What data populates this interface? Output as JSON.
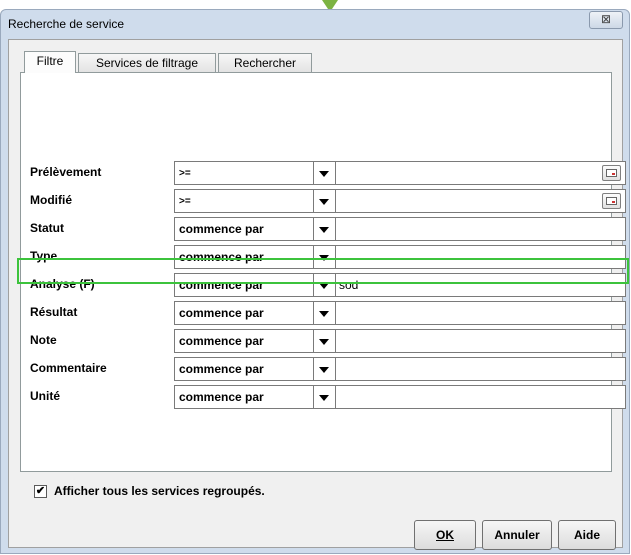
{
  "window": {
    "title": "Recherche de service",
    "close_symbol": "⊠"
  },
  "tabs": [
    {
      "label": "Filtre",
      "active": true
    },
    {
      "label": "Services de filtrage",
      "active": false
    },
    {
      "label": "Rechercher",
      "active": false
    }
  ],
  "filters": [
    {
      "label": "Prélèvement",
      "operator": ">=",
      "value": "",
      "has_calendar": true
    },
    {
      "label": "Modifié",
      "operator": ">=",
      "value": "",
      "has_calendar": true
    },
    {
      "label": "Statut",
      "operator": "commence par",
      "value": ""
    },
    {
      "label": "Type",
      "operator": "commence par",
      "value": ""
    },
    {
      "label": "Analyse (F)",
      "operator": "commence par",
      "value": "sod",
      "highlighted": true
    },
    {
      "label": "Résultat",
      "operator": "commence par",
      "value": ""
    },
    {
      "label": "Note",
      "operator": "commence par",
      "value": ""
    },
    {
      "label": "Commentaire",
      "operator": "commence par",
      "value": ""
    },
    {
      "label": "Unité",
      "operator": "commence par",
      "value": ""
    }
  ],
  "options": {
    "show_grouped_label": "Afficher tous les services regroupés.",
    "show_grouped_checked": true,
    "check_mark": "✔"
  },
  "buttons": {
    "ok": "OK",
    "cancel": "Annuler",
    "help": "Aide"
  },
  "colors": {
    "highlight": "#3cc33c",
    "pointer": "#7cb342",
    "title_bar": "#cfdcec"
  }
}
